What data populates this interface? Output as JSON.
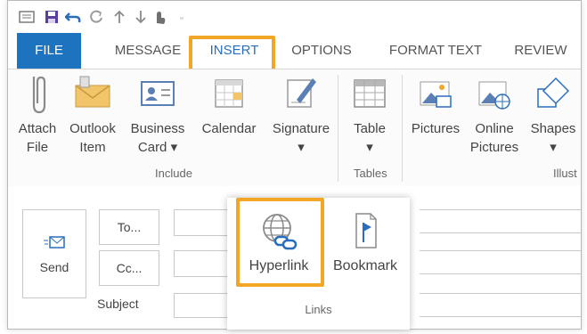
{
  "tabs": [
    "FILE",
    "MESSAGE",
    "INSERT",
    "OPTIONS",
    "FORMAT TEXT",
    "REVIEW"
  ],
  "ribbon": {
    "attach_file": [
      "Attach",
      "File"
    ],
    "outlook_item": [
      "Outlook",
      "Item"
    ],
    "business_card": [
      "Business",
      "Card ▾"
    ],
    "calendar": "Calendar",
    "signature": [
      "Signature",
      "▾"
    ],
    "table": [
      "Table",
      "▾"
    ],
    "pictures": "Pictures",
    "online_pictures": [
      "Online",
      "Pictures"
    ],
    "shapes": [
      "Shapes",
      "▾"
    ],
    "group_include": "Include",
    "group_tables": "Tables",
    "group_illustrations": "Illust"
  },
  "compose": {
    "send": "Send",
    "to": "To...",
    "cc": "Cc...",
    "subject": "Subject"
  },
  "links": {
    "hyperlink": "Hyperlink",
    "bookmark": "Bookmark",
    "group_label": "Links"
  },
  "colors": {
    "file_tab": "#1e73be",
    "accent": "#2a6ebb",
    "highlight": "#f2a628"
  }
}
